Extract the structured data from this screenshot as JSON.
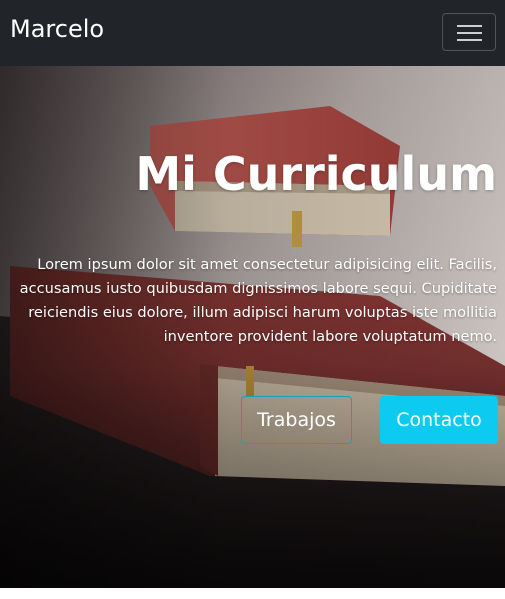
{
  "navbar": {
    "brand": "Marcelo",
    "toggle_icon": "hamburger-menu-icon"
  },
  "hero": {
    "background": "photo of a stack of old red books on a dark wooden table",
    "title": "Mi Curriculum",
    "text": "Lorem ipsum dolor sit amet consectetur adipisicing elit. Facilis, accusamus iusto quibusdam dignissimos labore sequi. Cupiditate reiciendis eius dolore, illum adipisci harum voluptas iste mollitia inventore provident labore voluptatum nemo.",
    "buttons": [
      {
        "label": "Trabajos",
        "style": "outline",
        "color": "#17a2b8"
      },
      {
        "label": "Contacto",
        "style": "solid",
        "color": "#0dcaf0"
      }
    ]
  },
  "colors": {
    "navbar_bg": "#212529",
    "accent": "#0dcaf0",
    "text_light": "#ffffff"
  }
}
